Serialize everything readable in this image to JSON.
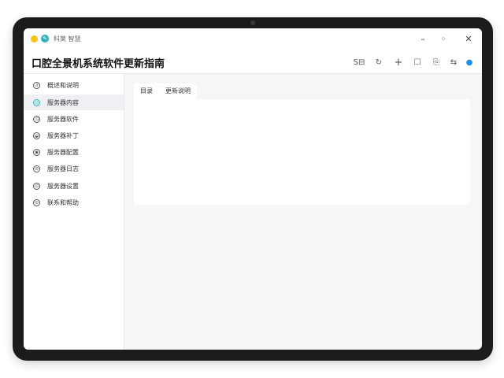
{
  "window": {
    "app_name": "科莱 智慧",
    "title": "口腔全景机系统软件更新指南",
    "controls": {
      "minimize": "–",
      "restore": "◦",
      "close": "✕"
    }
  },
  "toolbar": {
    "items": [
      {
        "name": "text-tool",
        "label": "S⊟"
      },
      {
        "name": "refresh-icon",
        "label": "↻"
      },
      {
        "name": "add-icon",
        "label": "+"
      },
      {
        "name": "window-icon",
        "label": "☐"
      },
      {
        "name": "file-icon",
        "label": "⎘"
      },
      {
        "name": "layout-icon",
        "label": "⇆"
      },
      {
        "name": "chat-icon",
        "label": "●"
      }
    ]
  },
  "sidebar": {
    "items": [
      {
        "label": "概述和说明",
        "icon": "∂"
      },
      {
        "label": "服务器内容",
        "icon": "◎"
      },
      {
        "label": "服务器软件",
        "icon": "◷"
      },
      {
        "label": "服务器补丁",
        "icon": "◒"
      },
      {
        "label": "服务器配置",
        "icon": "◉"
      },
      {
        "label": "服务器日志",
        "icon": "⊜"
      },
      {
        "label": "服务器设置",
        "icon": "⊙"
      },
      {
        "label": "联系和帮助",
        "icon": "⊝"
      }
    ],
    "active_index": 1
  },
  "tabs": [
    {
      "label": "目录"
    },
    {
      "label": "更新说明"
    }
  ],
  "colors": {
    "accent_yellow": "#f5c518",
    "accent_teal": "#2ab0c5",
    "chat_blue": "#1e8fe8"
  }
}
